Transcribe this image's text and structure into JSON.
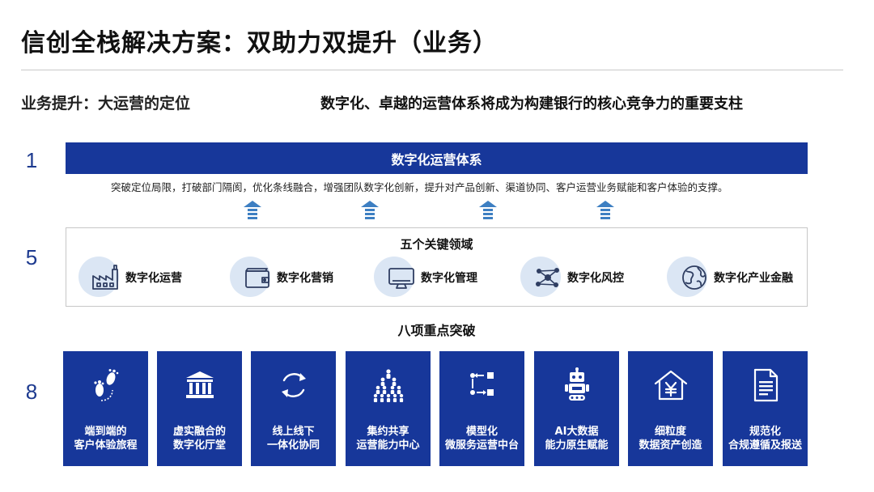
{
  "title": "信创全栈解决方案：双助力双提升（业务）",
  "subtitle_left": "业务提升：大运营的定位",
  "subtitle_right": "数字化、卓越的运营体系将成为构建银行的核心竞争力的重要支柱",
  "row_numbers": [
    "1",
    "5",
    "8"
  ],
  "system": {
    "label": "数字化运营体系",
    "description": "突破定位局限，打破部门隔阂，优化条线融合，增强团队数字化创新，提升对产品创新、渠道协同、客户运营业务赋能和客户体验的支撑。"
  },
  "domains": {
    "title": "五个关键领域",
    "items": [
      {
        "label": "数字化运营",
        "icon": "factory-icon"
      },
      {
        "label": "数字化营销",
        "icon": "wallet-icon"
      },
      {
        "label": "数字化管理",
        "icon": "monitor-icon"
      },
      {
        "label": "数字化风控",
        "icon": "network-icon"
      },
      {
        "label": "数字化产业金融",
        "icon": "globe-icon"
      }
    ]
  },
  "breakthroughs": {
    "title": "八项重点突破",
    "items": [
      {
        "line1": "端到端的",
        "line2": "客户体验旅程",
        "icon": "footprints-icon"
      },
      {
        "line1": "虚实融合的",
        "line2": "数字化厅堂",
        "icon": "bank-building-icon"
      },
      {
        "line1": "线上线下",
        "line2": "一体化协同",
        "icon": "sync-icon"
      },
      {
        "line1": "集约共享",
        "line2": "运营能力中心",
        "icon": "people-group-icon"
      },
      {
        "line1": "模型化",
        "line2": "微服务运营中台",
        "icon": "flow-icon"
      },
      {
        "line1": "AI大数据",
        "line2": "能力原生赋能",
        "icon": "robot-icon"
      },
      {
        "line1": "细粒度",
        "line2": "数据资产创造",
        "icon": "yuan-house-icon"
      },
      {
        "line1": "规范化",
        "line2": "合规遵循及报送",
        "icon": "document-icon"
      }
    ]
  },
  "colors": {
    "primary": "#17379a",
    "circle": "#dbe6f4",
    "arrow": "#3d7fc2"
  }
}
